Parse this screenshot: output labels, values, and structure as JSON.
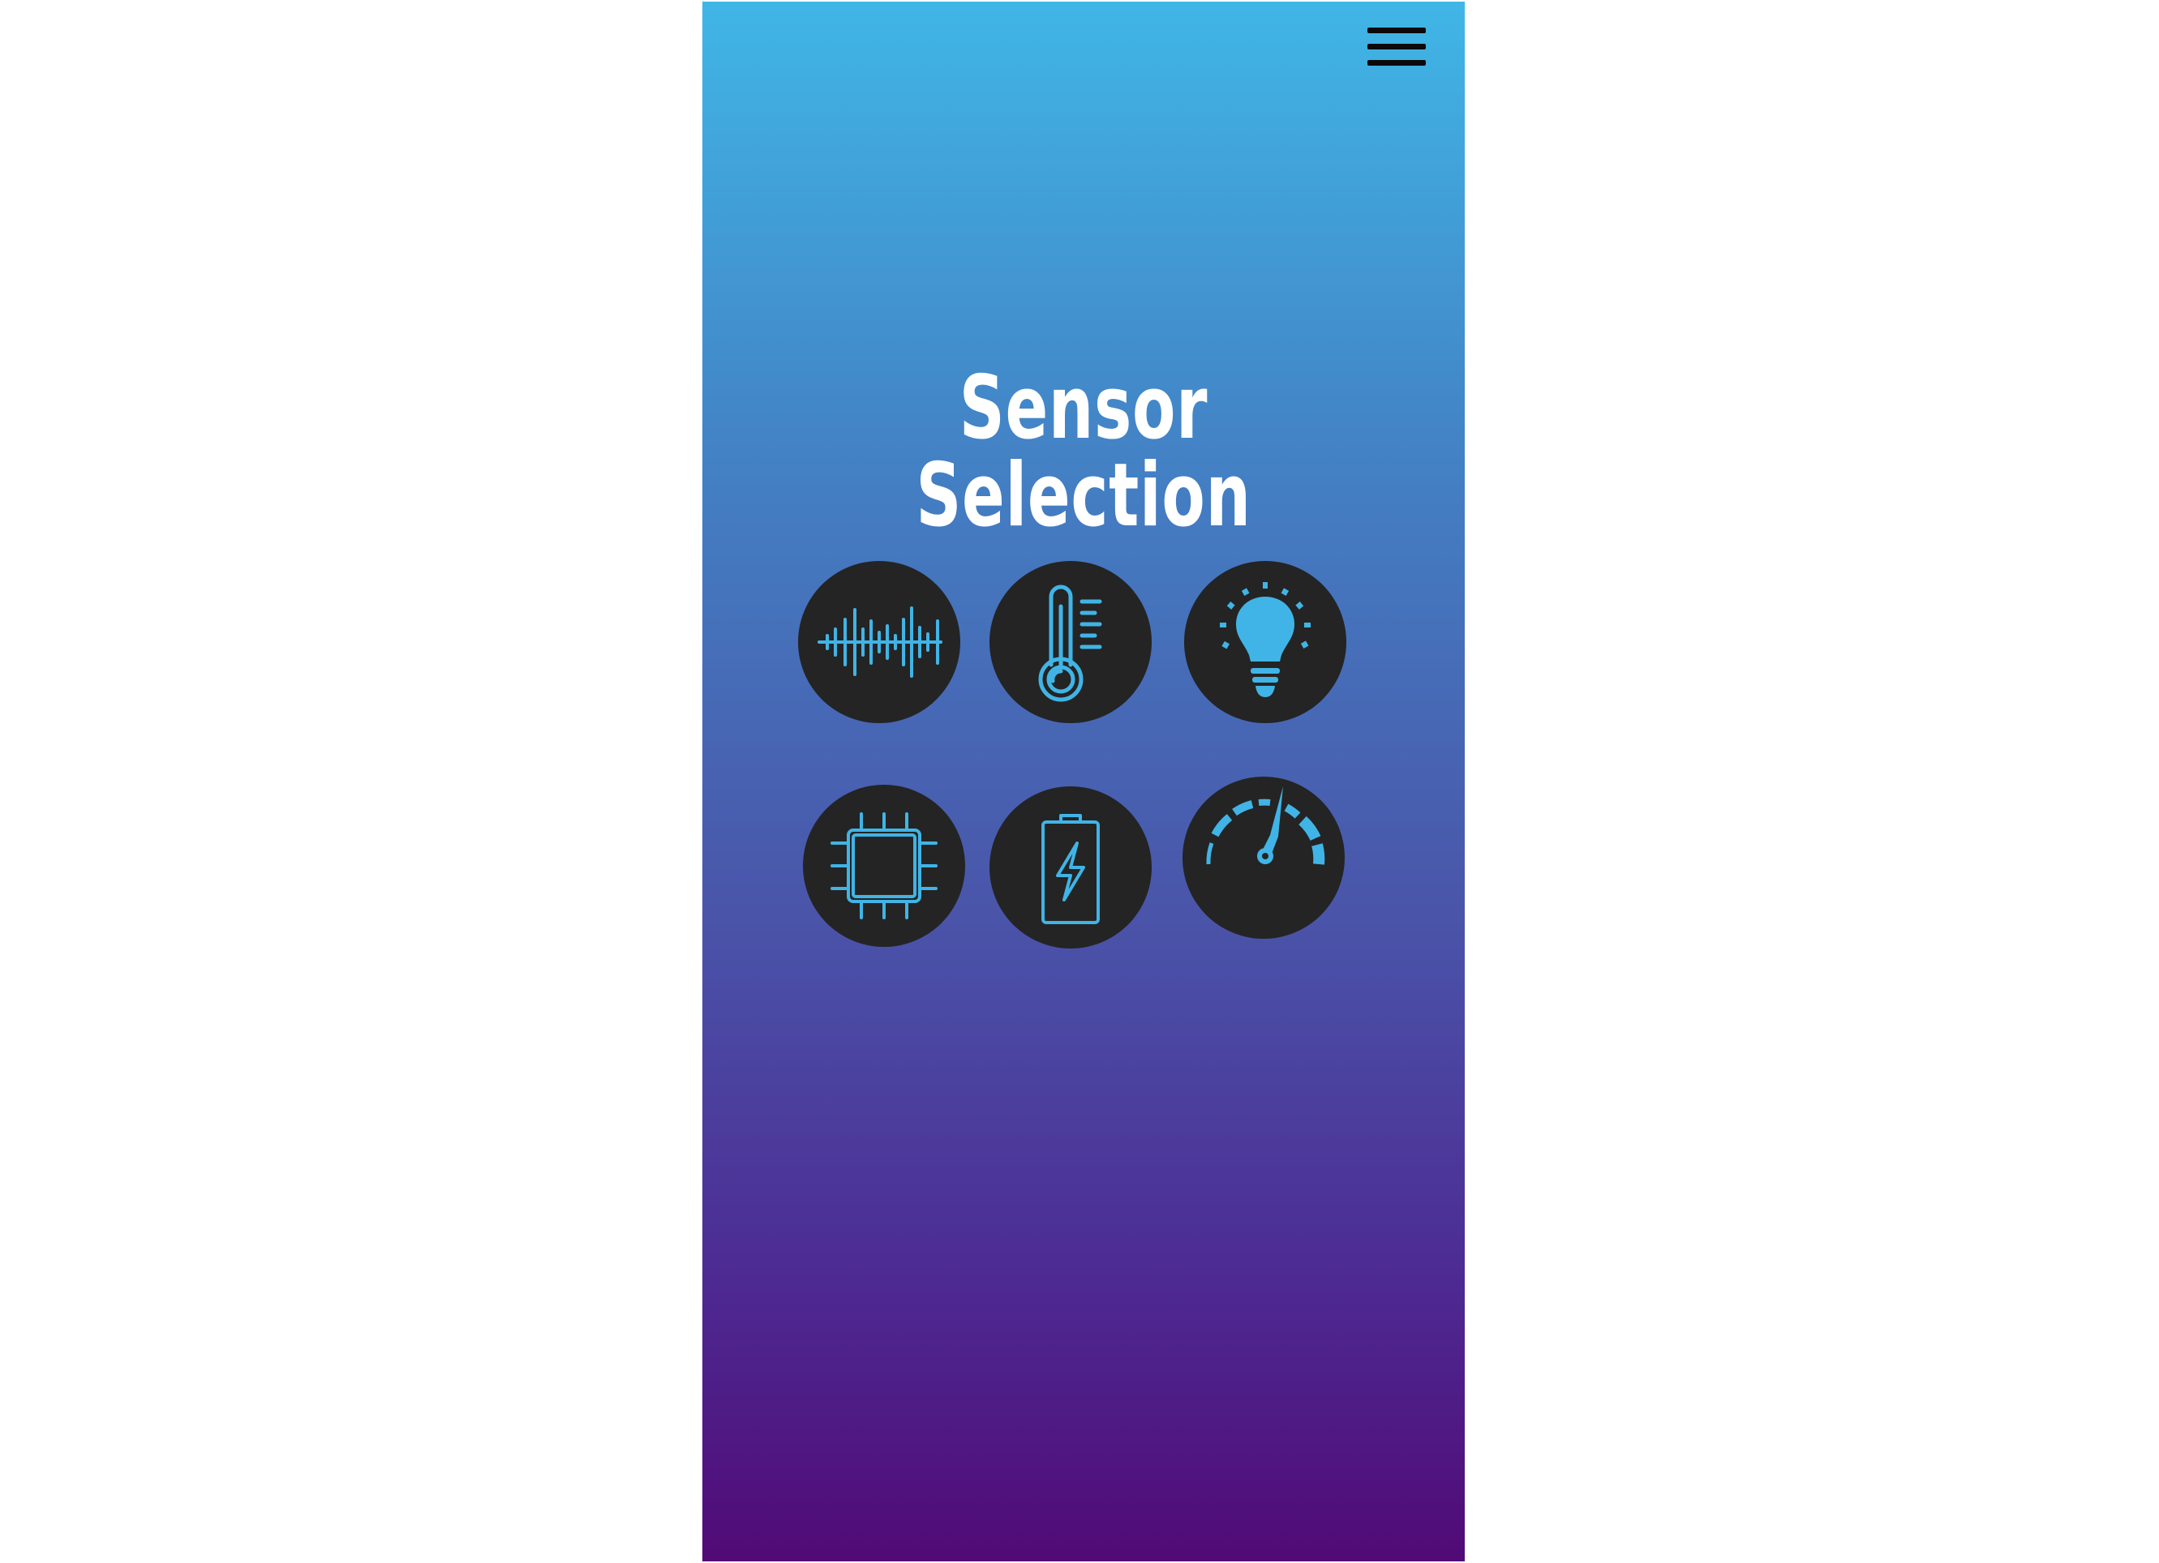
{
  "header": {
    "menu_icon": "hamburger-menu-icon"
  },
  "page": {
    "title": "Sensor Selection"
  },
  "colors": {
    "gradient_top": "#40b6e6",
    "gradient_bottom": "#510a76",
    "icon_circle": "#242424",
    "icon_accent": "#40b4e6",
    "title_text": "#ffffff"
  },
  "sensors": [
    {
      "icon": "sound-wave-icon"
    },
    {
      "icon": "thermometer-icon"
    },
    {
      "icon": "light-bulb-icon"
    },
    {
      "icon": "microchip-icon"
    },
    {
      "icon": "battery-icon"
    },
    {
      "icon": "speedometer-icon"
    }
  ]
}
